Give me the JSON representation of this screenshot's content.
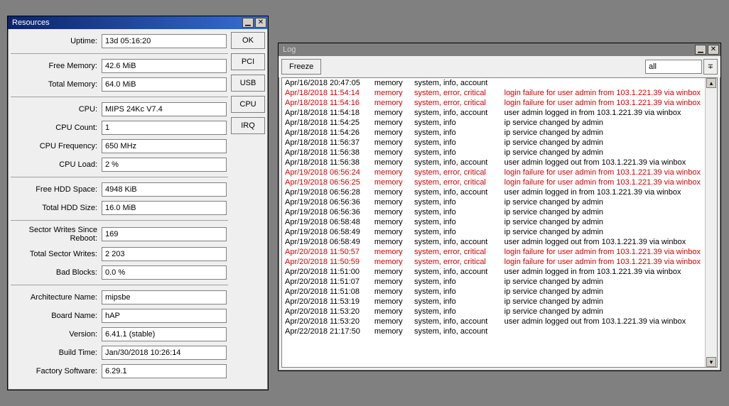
{
  "resources": {
    "title": "Resources",
    "buttons": {
      "ok": "OK",
      "pci": "PCI",
      "usb": "USB",
      "cpu": "CPU",
      "irq": "IRQ"
    },
    "groups": [
      [
        {
          "label": "Uptime:",
          "value": "13d 05:16:20"
        }
      ],
      [
        {
          "label": "Free Memory:",
          "value": "42.6 MiB"
        },
        {
          "label": "Total Memory:",
          "value": "64.0 MiB"
        }
      ],
      [
        {
          "label": "CPU:",
          "value": "MIPS 24Kc V7.4"
        },
        {
          "label": "CPU Count:",
          "value": "1"
        },
        {
          "label": "CPU Frequency:",
          "value": "650 MHz"
        },
        {
          "label": "CPU Load:",
          "value": "2 %"
        }
      ],
      [
        {
          "label": "Free HDD Space:",
          "value": "4948 KiB"
        },
        {
          "label": "Total HDD Size:",
          "value": "16.0 MiB"
        }
      ],
      [
        {
          "label": "Sector Writes Since Reboot:",
          "value": "169"
        },
        {
          "label": "Total Sector Writes:",
          "value": "2 203"
        },
        {
          "label": "Bad Blocks:",
          "value": "0.0 %"
        }
      ],
      [
        {
          "label": "Architecture Name:",
          "value": "mipsbe"
        },
        {
          "label": "Board Name:",
          "value": "hAP"
        },
        {
          "label": "Version:",
          "value": "6.41.1 (stable)"
        },
        {
          "label": "Build Time:",
          "value": "Jan/30/2018 10:26:14"
        },
        {
          "label": "Factory Software:",
          "value": "6.29.1"
        }
      ]
    ]
  },
  "log": {
    "title": "Log",
    "freeze": "Freeze",
    "filter": "all",
    "rows": [
      {
        "t": "Apr/16/2018 20:47:05",
        "b": "memory",
        "topic": "system, info, account",
        "msg": "",
        "err": false
      },
      {
        "t": "Apr/18/2018 11:54:14",
        "b": "memory",
        "topic": "system, error, critical",
        "msg": "login failure for user admin from 103.1.221.39 via winbox",
        "err": true
      },
      {
        "t": "Apr/18/2018 11:54:16",
        "b": "memory",
        "topic": "system, error, critical",
        "msg": "login failure for user admin from 103.1.221.39 via winbox",
        "err": true
      },
      {
        "t": "Apr/18/2018 11:54:18",
        "b": "memory",
        "topic": "system, info, account",
        "msg": "user admin logged in from 103.1.221.39 via winbox",
        "err": false
      },
      {
        "t": "Apr/18/2018 11:54:25",
        "b": "memory",
        "topic": "system, info",
        "msg": "ip service changed by admin",
        "err": false
      },
      {
        "t": "Apr/18/2018 11:54:26",
        "b": "memory",
        "topic": "system, info",
        "msg": "ip service changed by admin",
        "err": false
      },
      {
        "t": "Apr/18/2018 11:56:37",
        "b": "memory",
        "topic": "system, info",
        "msg": "ip service changed by admin",
        "err": false
      },
      {
        "t": "Apr/18/2018 11:56:38",
        "b": "memory",
        "topic": "system, info",
        "msg": "ip service changed by admin",
        "err": false
      },
      {
        "t": "Apr/18/2018 11:56:38",
        "b": "memory",
        "topic": "system, info, account",
        "msg": "user admin logged out from 103.1.221.39 via winbox",
        "err": false
      },
      {
        "t": "Apr/19/2018 06:56:24",
        "b": "memory",
        "topic": "system, error, critical",
        "msg": "login failure for user admin from 103.1.221.39 via winbox",
        "err": true
      },
      {
        "t": "Apr/19/2018 06:56:25",
        "b": "memory",
        "topic": "system, error, critical",
        "msg": "login failure for user admin from 103.1.221.39 via winbox",
        "err": true
      },
      {
        "t": "Apr/19/2018 06:56:28",
        "b": "memory",
        "topic": "system, info, account",
        "msg": "user admin logged in from 103.1.221.39 via winbox",
        "err": false
      },
      {
        "t": "Apr/19/2018 06:56:36",
        "b": "memory",
        "topic": "system, info",
        "msg": "ip service changed by admin",
        "err": false
      },
      {
        "t": "Apr/19/2018 06:56:36",
        "b": "memory",
        "topic": "system, info",
        "msg": "ip service changed by admin",
        "err": false
      },
      {
        "t": "Apr/19/2018 06:58:48",
        "b": "memory",
        "topic": "system, info",
        "msg": "ip service changed by admin",
        "err": false
      },
      {
        "t": "Apr/19/2018 06:58:49",
        "b": "memory",
        "topic": "system, info",
        "msg": "ip service changed by admin",
        "err": false
      },
      {
        "t": "Apr/19/2018 06:58:49",
        "b": "memory",
        "topic": "system, info, account",
        "msg": "user admin logged out from 103.1.221.39 via winbox",
        "err": false
      },
      {
        "t": "Apr/20/2018 11:50:57",
        "b": "memory",
        "topic": "system, error, critical",
        "msg": "login failure for user admin from 103.1.221.39 via winbox",
        "err": true
      },
      {
        "t": "Apr/20/2018 11:50:59",
        "b": "memory",
        "topic": "system, error, critical",
        "msg": "login failure for user admin from 103.1.221.39 via winbox",
        "err": true
      },
      {
        "t": "Apr/20/2018 11:51:00",
        "b": "memory",
        "topic": "system, info, account",
        "msg": "user admin logged in from 103.1.221.39 via winbox",
        "err": false
      },
      {
        "t": "Apr/20/2018 11:51:07",
        "b": "memory",
        "topic": "system, info",
        "msg": "ip service changed by admin",
        "err": false
      },
      {
        "t": "Apr/20/2018 11:51:08",
        "b": "memory",
        "topic": "system, info",
        "msg": "ip service changed by admin",
        "err": false
      },
      {
        "t": "Apr/20/2018 11:53:19",
        "b": "memory",
        "topic": "system, info",
        "msg": "ip service changed by admin",
        "err": false
      },
      {
        "t": "Apr/20/2018 11:53:20",
        "b": "memory",
        "topic": "system, info",
        "msg": "ip service changed by admin",
        "err": false
      },
      {
        "t": "Apr/20/2018 11:53:20",
        "b": "memory",
        "topic": "system, info, account",
        "msg": "user admin logged out from 103.1.221.39 via winbox",
        "err": false
      },
      {
        "t": "Apr/22/2018 21:17:50",
        "b": "memory",
        "topic": "system, info, account",
        "msg": "",
        "err": false
      }
    ]
  }
}
